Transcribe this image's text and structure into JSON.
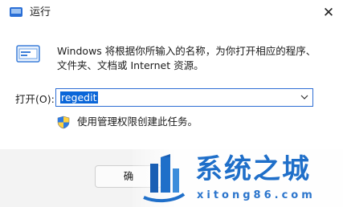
{
  "window": {
    "title": "运行",
    "close_glyph": "✕"
  },
  "content": {
    "description_line1": "Windows 将根据你所输入的名称，为你打开相应的程序、",
    "description_line2": "文件夹、文档或 Internet 资源。",
    "open_label": "打开(O):",
    "open_value": "regedit",
    "admin_text": "使用管理权限创建此任务。"
  },
  "footer": {
    "ok_label": "确"
  },
  "watermark": {
    "name": "系统之城",
    "domain": "xitong86.com"
  },
  "colors": {
    "accent": "#0a66d8",
    "watermark_blue": "#1f6fc9"
  },
  "icons": [
    "app-run-icon",
    "close-icon",
    "run-dialog-icon",
    "chevron-down-icon",
    "uac-shield-icon",
    "site-logo-icon"
  ]
}
